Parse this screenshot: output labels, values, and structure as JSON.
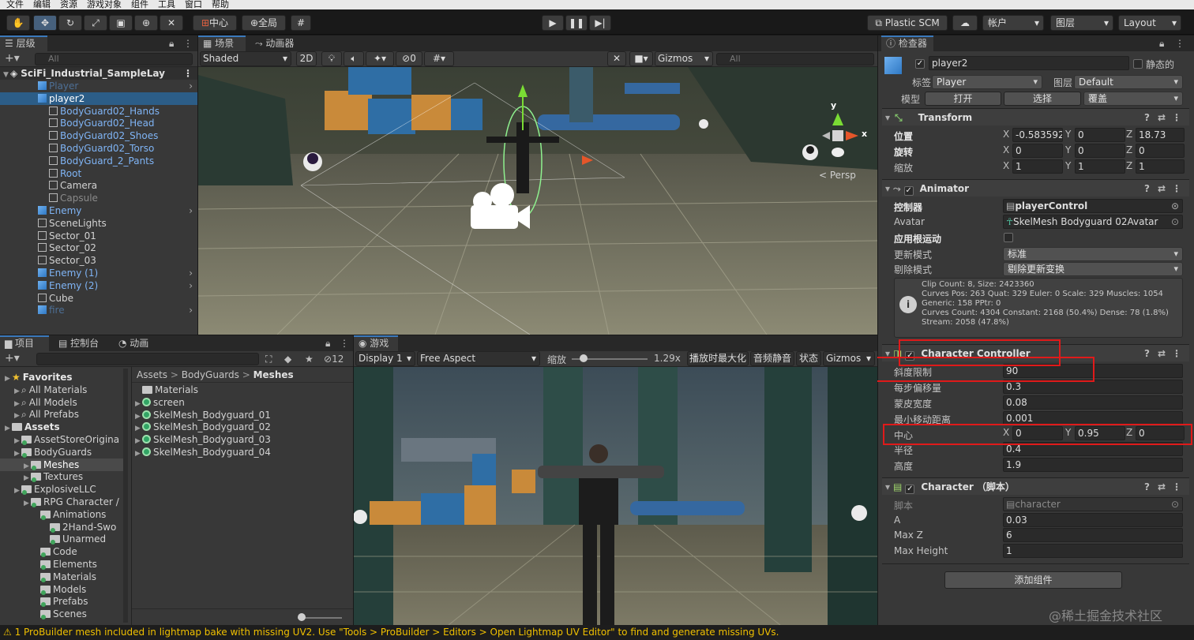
{
  "menu": [
    "文件",
    "编辑",
    "资源",
    "游戏对象",
    "组件",
    "工具",
    "窗口",
    "帮助"
  ],
  "toolbar": {
    "center_btn": "中心",
    "global_btn": "全局",
    "plastic": "Plastic SCM",
    "account": "帐户",
    "layers": "图层",
    "layout": "Layout"
  },
  "hierarchy": {
    "tab": "层级",
    "search_placeholder": "All",
    "scene": "SciFi_Industrial_SampleLay",
    "items": [
      {
        "label": "Player",
        "style": "dimblue",
        "indent": 1,
        "icon": "cube-blue"
      },
      {
        "label": "player2",
        "style": "sel",
        "indent": 1,
        "icon": "cube-blue"
      },
      {
        "label": "BodyGuard02_Hands",
        "style": "blue",
        "indent": 2,
        "icon": "cube-grey"
      },
      {
        "label": "BodyGuard02_Head",
        "style": "blue",
        "indent": 2,
        "icon": "cube-grey"
      },
      {
        "label": "BodyGuard02_Shoes",
        "style": "blue",
        "indent": 2,
        "icon": "cube-grey"
      },
      {
        "label": "BodyGuard02_Torso",
        "style": "blue",
        "indent": 2,
        "icon": "cube-grey"
      },
      {
        "label": "BodyGuard_2_Pants",
        "style": "blue",
        "indent": 2,
        "icon": "cube-grey"
      },
      {
        "label": "Root",
        "style": "blue",
        "indent": 2,
        "icon": "cube-grey"
      },
      {
        "label": "Camera",
        "style": "normal",
        "indent": 2,
        "icon": "cube-grey"
      },
      {
        "label": "Capsule",
        "style": "dim",
        "indent": 2,
        "icon": "cube-grey"
      },
      {
        "label": "Enemy",
        "style": "blue",
        "indent": 1,
        "icon": "cube-blue"
      },
      {
        "label": "SceneLights",
        "style": "normal",
        "indent": 1,
        "icon": "cube-grey"
      },
      {
        "label": "Sector_01",
        "style": "normal",
        "indent": 1,
        "icon": "cube-grey"
      },
      {
        "label": "Sector_02",
        "style": "normal",
        "indent": 1,
        "icon": "cube-grey"
      },
      {
        "label": "Sector_03",
        "style": "normal",
        "indent": 1,
        "icon": "cube-grey"
      },
      {
        "label": "Enemy (1)",
        "style": "blue",
        "indent": 1,
        "icon": "cube-blue"
      },
      {
        "label": "Enemy (2)",
        "style": "blue",
        "indent": 1,
        "icon": "cube-blue"
      },
      {
        "label": "Cube",
        "style": "normal",
        "indent": 1,
        "icon": "cube-grey"
      },
      {
        "label": "fire",
        "style": "dimblue",
        "indent": 1,
        "icon": "cube-blue"
      }
    ]
  },
  "scene": {
    "tab_scene": "场景",
    "tab_animator": "动画器",
    "shading": "Shaded",
    "mode2d": "2D",
    "hidden_count": "0",
    "gizmos": "Gizmos",
    "search": "All",
    "persp": "< Persp",
    "axis_x": "x",
    "axis_y": "y"
  },
  "project": {
    "tab_project": "项目",
    "tab_console": "控制台",
    "tab_anim": "动画",
    "badge": "12",
    "tree": [
      {
        "label": "Favorites",
        "bold": true,
        "indent": 0
      },
      {
        "label": "All Materials",
        "indent": 1
      },
      {
        "label": "All Models",
        "indent": 1
      },
      {
        "label": "All Prefabs",
        "indent": 1
      },
      {
        "label": "Assets",
        "bold": true,
        "indent": 0
      },
      {
        "label": "AssetStoreOrigina",
        "indent": 1
      },
      {
        "label": "BodyGuards",
        "indent": 1
      },
      {
        "label": "Meshes",
        "indent": 2,
        "sel": true
      },
      {
        "label": "Textures",
        "indent": 2
      },
      {
        "label": "ExplosiveLLC",
        "indent": 1
      },
      {
        "label": "RPG Character /",
        "indent": 2
      },
      {
        "label": "Animations",
        "indent": 3
      },
      {
        "label": "2Hand-Swo",
        "indent": 4
      },
      {
        "label": "Unarmed",
        "indent": 4
      },
      {
        "label": "Code",
        "indent": 3
      },
      {
        "label": "Elements",
        "indent": 3
      },
      {
        "label": "Materials",
        "indent": 3
      },
      {
        "label": "Models",
        "indent": 3
      },
      {
        "label": "Prefabs",
        "indent": 3
      },
      {
        "label": "Scenes",
        "indent": 3
      }
    ],
    "breadcrumb": [
      "Assets",
      "BodyGuards",
      "Meshes"
    ],
    "files": [
      "Materials",
      "screen",
      "SkelMesh_Bodyguard_01",
      "SkelMesh_Bodyguard_02",
      "SkelMesh_Bodyguard_03",
      "SkelMesh_Bodyguard_04"
    ]
  },
  "game": {
    "tab": "游戏",
    "display": "Display 1",
    "aspect": "Free Aspect",
    "scale_label": "缩放",
    "scale_value": "1.29x",
    "maximize": "播放时最大化",
    "mute": "音频静音",
    "stats": "状态",
    "gizmos": "Gizmos"
  },
  "inspector": {
    "tab": "检查器",
    "object_name": "player2",
    "static_label": "静态的",
    "tag_label": "标签",
    "tag_value": "Player",
    "layer_label": "图层",
    "layer_value": "Default",
    "model_label": "模型",
    "open": "打开",
    "select": "选择",
    "override": "覆盖",
    "transform": {
      "title": "Transform",
      "position": "位置",
      "rotation": "旋转",
      "scale": "缩放",
      "pos": [
        "-0.583592",
        "0",
        "18.73"
      ],
      "rot": [
        "0",
        "0",
        "0"
      ],
      "scl": [
        "1",
        "1",
        "1"
      ]
    },
    "animator": {
      "title": "Animator",
      "controller_label": "控制器",
      "controller_value": "playerControl",
      "avatar_label": "Avatar",
      "avatar_value": "SkelMesh Bodyguard 02Avatar",
      "root_motion": "应用根运动",
      "update_label": "更新模式",
      "update_value": "标准",
      "culling_label": "剔除模式",
      "culling_value": "剔除更新变换",
      "info": [
        "Clip Count: 8, Size: 2423360",
        "Curves Pos: 263 Quat: 329 Euler: 0 Scale: 329 Muscles: 1054",
        "Generic: 158 PPtr: 0",
        "Curves Count: 4304 Constant: 2168 (50.4%) Dense: 78 (1.8%)",
        "Stream: 2058 (47.8%)"
      ]
    },
    "cc": {
      "title": "Character Controller",
      "slope_label": "斜度限制",
      "slope": "90",
      "step_label": "每步偏移量",
      "step": "0.3",
      "skin_label": "蒙皮宽度",
      "skin": "0.08",
      "minmove_label": "最小移动距离",
      "minmove": "0.001",
      "center_label": "中心",
      "center": [
        "0",
        "0.95",
        "0"
      ],
      "radius_label": "半径",
      "radius": "0.4",
      "height_label": "高度",
      "height": "1.9"
    },
    "character": {
      "title": "Character （脚本）",
      "script_label": "脚本",
      "script_value": "character",
      "a_label": "A",
      "a": "0.03",
      "maxz_label": "Max Z",
      "maxz": "6",
      "maxh_label": "Max Height",
      "maxh": "1"
    },
    "add_component": "添加组件",
    "axes": [
      "X",
      "Y",
      "Z"
    ]
  },
  "status": "1 ProBuilder mesh included in lightmap bake with missing UV2. Use \"Tools > ProBuilder > Editors > Open Lightmap UV Editor\" to find and generate missing UVs.",
  "watermark": "@稀土掘金技术社区"
}
